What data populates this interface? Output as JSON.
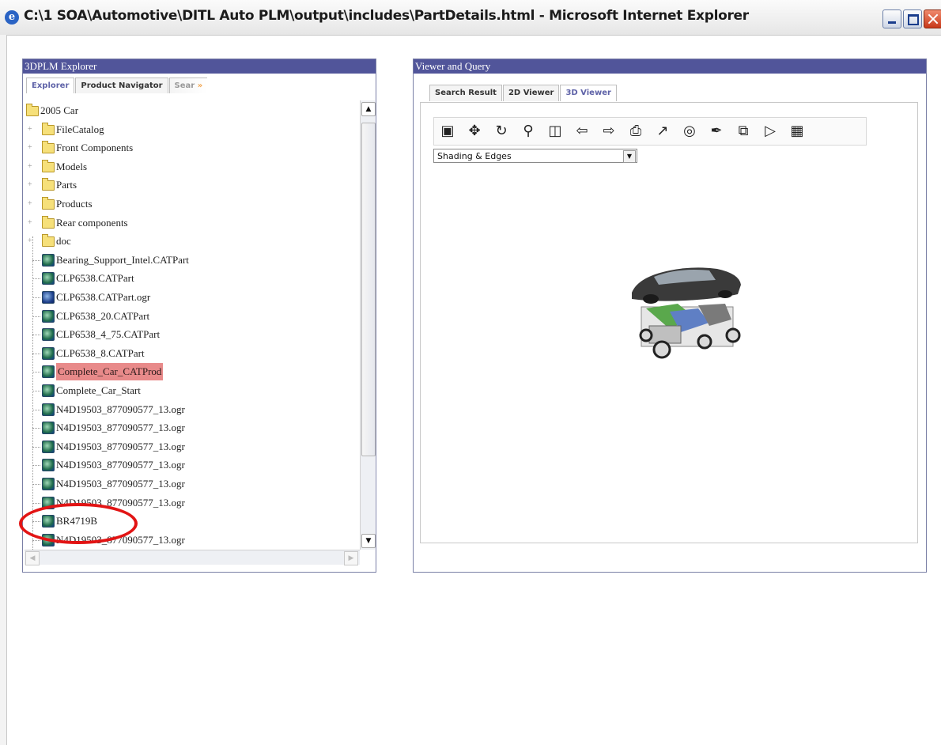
{
  "window": {
    "title": "C:\\1 SOA\\Automotive\\DITL Auto PLM\\output\\includes\\PartDetails.html - Microsoft Internet Explorer",
    "icon": "ie-page-icon",
    "controls": [
      "minimize",
      "maximize",
      "close"
    ]
  },
  "left_panel": {
    "title": "3DPLM Explorer",
    "tabs": [
      {
        "label": "Explorer",
        "active": true
      },
      {
        "label": "Product Navigator",
        "active": false
      },
      {
        "label": "Sear",
        "active": false
      }
    ],
    "tree": [
      {
        "label": "2005 Car",
        "type": "folder",
        "level": 0
      },
      {
        "label": "FileCatalog",
        "type": "folder",
        "level": 1,
        "expandable": true
      },
      {
        "label": "Front Components",
        "type": "folder",
        "level": 1,
        "expandable": true
      },
      {
        "label": "Models",
        "type": "folder",
        "level": 1,
        "expandable": true
      },
      {
        "label": "Parts",
        "type": "folder",
        "level": 1,
        "expandable": true
      },
      {
        "label": "Products",
        "type": "folder",
        "level": 1,
        "expandable": true
      },
      {
        "label": "Rear components",
        "type": "folder",
        "level": 1,
        "expandable": true
      },
      {
        "label": "doc",
        "type": "folder",
        "level": 1,
        "expandable": true
      },
      {
        "label": "Bearing_Support_Intel.CATPart",
        "type": "part",
        "level": 1
      },
      {
        "label": "CLP6538.CATPart",
        "type": "part",
        "level": 1
      },
      {
        "label": "CLP6538.CATPart.ogr",
        "type": "part-blue",
        "level": 1
      },
      {
        "label": "CLP6538_20.CATPart",
        "type": "part",
        "level": 1
      },
      {
        "label": "CLP6538_4_75.CATPart",
        "type": "part",
        "level": 1
      },
      {
        "label": "CLP6538_8.CATPart",
        "type": "part",
        "level": 1
      },
      {
        "label": "Complete_Car_CATProd",
        "type": "part",
        "level": 1,
        "highlighted": true
      },
      {
        "label": "Complete_Car_Start",
        "type": "part",
        "level": 1
      },
      {
        "label": "N4D19503_877090577_13.ogr",
        "type": "part",
        "level": 1
      },
      {
        "label": "N4D19503_877090577_13.ogr",
        "type": "part",
        "level": 1
      },
      {
        "label": "N4D19503_877090577_13.ogr",
        "type": "part",
        "level": 1
      },
      {
        "label": "N4D19503_877090577_13.ogr",
        "type": "part",
        "level": 1
      },
      {
        "label": "N4D19503_877090577_13.ogr",
        "type": "part",
        "level": 1
      },
      {
        "label": "N4D19503_877090577_13.ogr",
        "type": "part",
        "level": 1
      },
      {
        "label": "BR4719B",
        "type": "part",
        "level": 1,
        "circled": true
      },
      {
        "label": "N4D19503_877090577_13.ogr",
        "type": "part",
        "level": 1
      }
    ]
  },
  "right_panel": {
    "title": "Viewer and Query",
    "tabs": [
      {
        "label": "Search Result",
        "active": false
      },
      {
        "label": "2D Viewer",
        "active": false
      },
      {
        "label": "3D Viewer",
        "active": true
      }
    ],
    "toolbar_icons": [
      "fit-all-icon",
      "pan-icon",
      "rotate-icon",
      "zoom-icon",
      "zoom-area-icon",
      "previous-view-icon",
      "next-view-icon",
      "print-icon",
      "measure-icon",
      "section-icon",
      "annotate-icon",
      "copy-icon",
      "select-icon",
      "properties-icon"
    ],
    "render_mode": {
      "selected": "Shading & Edges"
    }
  },
  "colors": {
    "panel_header": "#51559a",
    "highlight": "#e88a8a",
    "annotation": "#e21414"
  }
}
